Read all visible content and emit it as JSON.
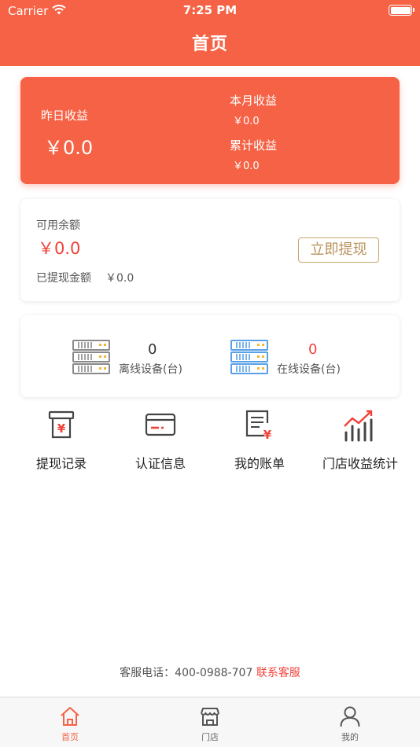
{
  "status_bar": {
    "carrier": "Carrier",
    "time": "7:25 PM"
  },
  "nav": {
    "title": "首页"
  },
  "earnings": {
    "yesterday_label": "昨日收益",
    "yesterday_value": "￥0.0",
    "month_label": "本月收益",
    "month_value": "￥0.0",
    "total_label": "累计收益",
    "total_value": "￥0.0"
  },
  "balance": {
    "available_label": "可用余额",
    "available_value": "￥0.0",
    "withdrawn_label": "已提现金额",
    "withdrawn_value": "￥0.0",
    "withdraw_button": "立即提现"
  },
  "devices": {
    "offline_count": "0",
    "offline_label": "离线设备(台)",
    "online_count": "0",
    "online_label": "在线设备(台)"
  },
  "quick_actions": [
    {
      "label": "提现记录",
      "icon": "withdraw-record-icon"
    },
    {
      "label": "认证信息",
      "icon": "card-icon"
    },
    {
      "label": "我的账单",
      "icon": "bill-icon"
    },
    {
      "label": "门店收益统计",
      "icon": "bar-chart-icon"
    }
  ],
  "service": {
    "label": "客服电话：",
    "phone": "400-0988-707",
    "link": "联系客服"
  },
  "tabs": [
    {
      "label": "首页",
      "icon": "home-icon",
      "active": true
    },
    {
      "label": "门店",
      "icon": "store-icon",
      "active": false
    },
    {
      "label": "我的",
      "icon": "user-icon",
      "active": false
    }
  ],
  "colors": {
    "primary": "#f56245",
    "accent_red": "#f0433a",
    "gold": "#c9a66b",
    "online_blue": "#5aa0e6"
  }
}
